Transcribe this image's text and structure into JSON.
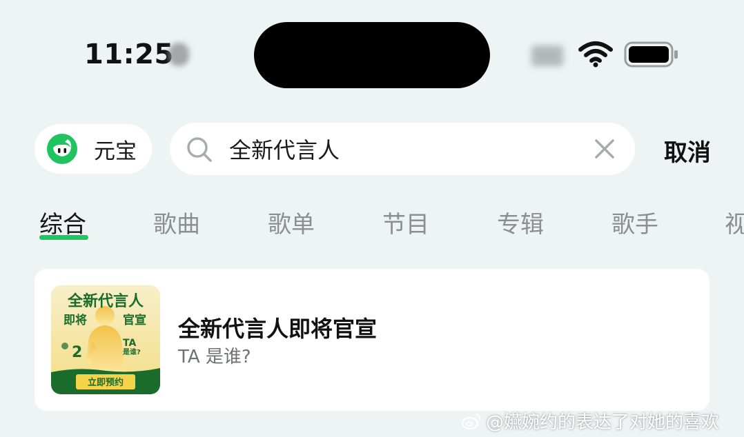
{
  "status_bar": {
    "time": "11:25"
  },
  "search": {
    "yuanbao_label": "元宝",
    "query": "全新代言人",
    "cancel_label": "取消"
  },
  "tabs": [
    "综合",
    "歌曲",
    "歌单",
    "节目",
    "专辑",
    "歌手",
    "视"
  ],
  "result": {
    "title": "全新代言人即将官宣",
    "subtitle": "TA 是谁?",
    "cover": {
      "headline_1": "全新代言人",
      "headline_2a": "即将",
      "headline_2b": "官宣",
      "who": "TA",
      "who_sub": "是谁?",
      "badge_num": "2",
      "button": "立即预约"
    }
  },
  "watermark": "@嬿婉约的表达了对她的喜欢",
  "colors": {
    "accent_green": "#1ec662",
    "cover_green": "#1b6b2c",
    "cover_yellow": "#f4d24a",
    "background": "#eef3f3"
  },
  "icons": {
    "wifi": "wifi-icon",
    "battery": "battery-icon",
    "search": "search-icon",
    "clear": "close-icon",
    "logo": "yuanbao-logo-icon",
    "weibo": "weibo-icon"
  }
}
